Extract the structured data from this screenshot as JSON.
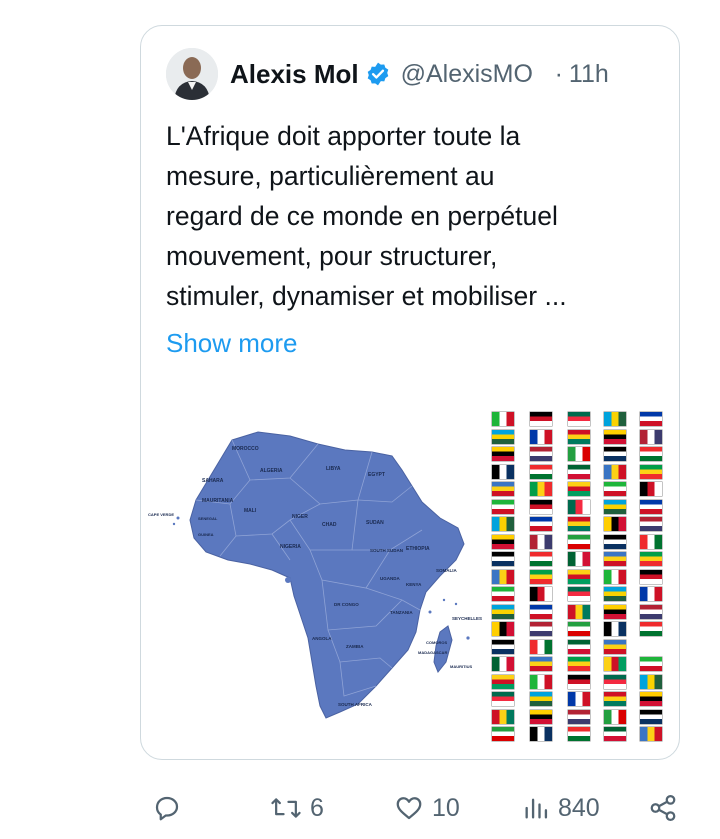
{
  "tweet": {
    "author_name": "Alexis Mol",
    "handle": "@AlexisMO",
    "time_sep": "·",
    "time": "11h",
    "text": "L'Afrique doit apporter toute la\nmesure,  particulièrement au\nregard de ce monde en perpétuel\nmouvement, pour structurer,\nstimuler, dynamiser et mobiliser ...",
    "show_more": "Show more"
  },
  "map_labels": {
    "morocco": "MOROCCO",
    "algeria": "ALGERIA",
    "libya": "LIBYA",
    "egypt": "EGYPT",
    "sahara": "SAHARA",
    "mauritania": "MAURITANIA",
    "mali": "MALI",
    "niger": "NIGER",
    "chad": "CHAD",
    "sudan": "SUDAN",
    "cape_verde": "CAPE VERDE",
    "senegal": "SENEGAL",
    "guinea": "GUINEA",
    "nigeria": "NIGERIA",
    "ethiopia": "ETHIOPIA",
    "south_sudan": "SOUTH SUDAN",
    "somalia": "SOMALIA",
    "uganda": "UGANDA",
    "kenya": "KENYA",
    "dr_congo": "DR CONGO",
    "tanzania": "TANZANIA",
    "seychelles": "SEYCHELLES",
    "angola": "ANGOLA",
    "zambia": "ZAMBIA",
    "comoros": "COMOROS",
    "madagascar": "MADAGASCAR",
    "mauritius": "MAURITIUS",
    "south_africa": "SOUTH AFRICA"
  },
  "actions": {
    "replies": "",
    "retweets": "6",
    "likes": "10",
    "views": "840"
  },
  "colors": {
    "map_fill": "#5b78bf",
    "link": "#1d9bf0",
    "verified": "#1d9bf0",
    "muted": "#536471"
  }
}
